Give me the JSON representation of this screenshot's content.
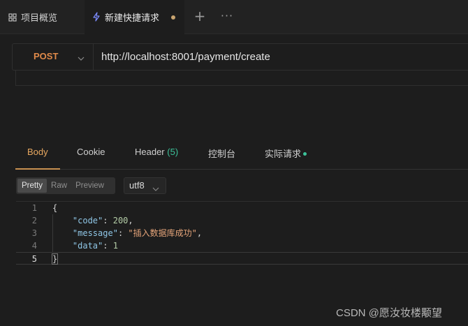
{
  "tabs": {
    "overview_label": "项目概览",
    "active_label": "新建快捷请求",
    "add_symbol": "+",
    "more_symbol": "···"
  },
  "request": {
    "method": "POST",
    "url": "http://localhost:8001/payment/create"
  },
  "response_tabs": {
    "body": "Body",
    "cookie": "Cookie",
    "header": "Header",
    "header_count": "(5)",
    "console": "控制台",
    "actual_request": "实际请求"
  },
  "view_modes": {
    "pretty": "Pretty",
    "raw": "Raw",
    "preview": "Preview",
    "encoding": "utf8"
  },
  "code": {
    "line_numbers": [
      "1",
      "2",
      "3",
      "4",
      "5"
    ],
    "open_brace": "{",
    "code_key": "\"code\"",
    "code_value": "200",
    "message_key": "\"message\"",
    "message_value": "\"插入数据库成功\"",
    "data_key": "\"data\"",
    "data_value": "1",
    "close_brace": "}"
  },
  "watermark": "CSDN @愿汝妆楼颙望",
  "colors": {
    "accent": "#c89050",
    "method_post": "#e08a4a",
    "status_green": "#3cc29a",
    "unsaved_dot": "#c8a470"
  }
}
